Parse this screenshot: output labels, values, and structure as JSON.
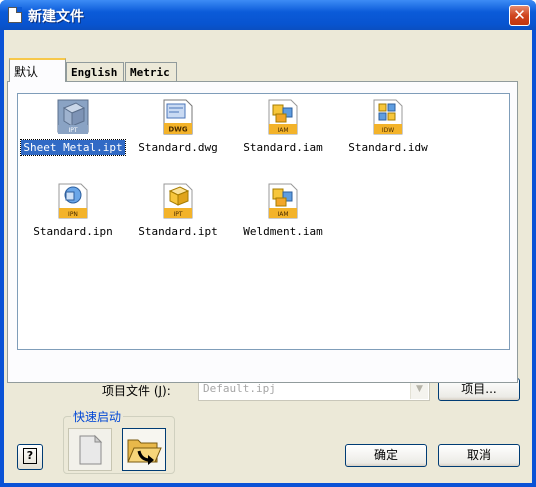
{
  "window": {
    "title": "新建文件",
    "close_glyph": "✕"
  },
  "tabs": [
    {
      "label": "默认",
      "active": true
    },
    {
      "label": "English",
      "active": false
    },
    {
      "label": "Metric",
      "active": false
    }
  ],
  "files": [
    {
      "name": "Sheet Metal.ipt",
      "badge": "IPT",
      "icon": "sheet-metal-part-icon",
      "selected": true
    },
    {
      "name": "Standard.dwg",
      "badge": "DWG",
      "icon": "drawing-dwg-icon",
      "selected": false
    },
    {
      "name": "Standard.iam",
      "badge": "IAM",
      "icon": "assembly-icon",
      "selected": false
    },
    {
      "name": "Standard.idw",
      "badge": "IDW",
      "icon": "drawing-idw-icon",
      "selected": false
    },
    {
      "name": "Standard.ipn",
      "badge": "IPN",
      "icon": "presentation-icon",
      "selected": false
    },
    {
      "name": "Standard.ipt",
      "badge": "IPT",
      "icon": "part-icon",
      "selected": false
    },
    {
      "name": "Weldment.iam",
      "badge": "IAM",
      "icon": "weldment-icon",
      "selected": false
    }
  ],
  "project": {
    "label": "项目文件 (",
    "hotkey": "J",
    "label_end": "):",
    "value": "Default.ipj",
    "button_label": "项目..."
  },
  "quick_launch": {
    "label": "快速启动",
    "new_icon": "blank-document-icon",
    "open_icon": "open-folder-icon"
  },
  "buttons": {
    "ok": "确定",
    "cancel": "取消",
    "help": "?"
  },
  "colors": {
    "titlebar": "#0b5bd9",
    "selection": "#316ac5",
    "dialog_bg": "#ece9d8"
  }
}
